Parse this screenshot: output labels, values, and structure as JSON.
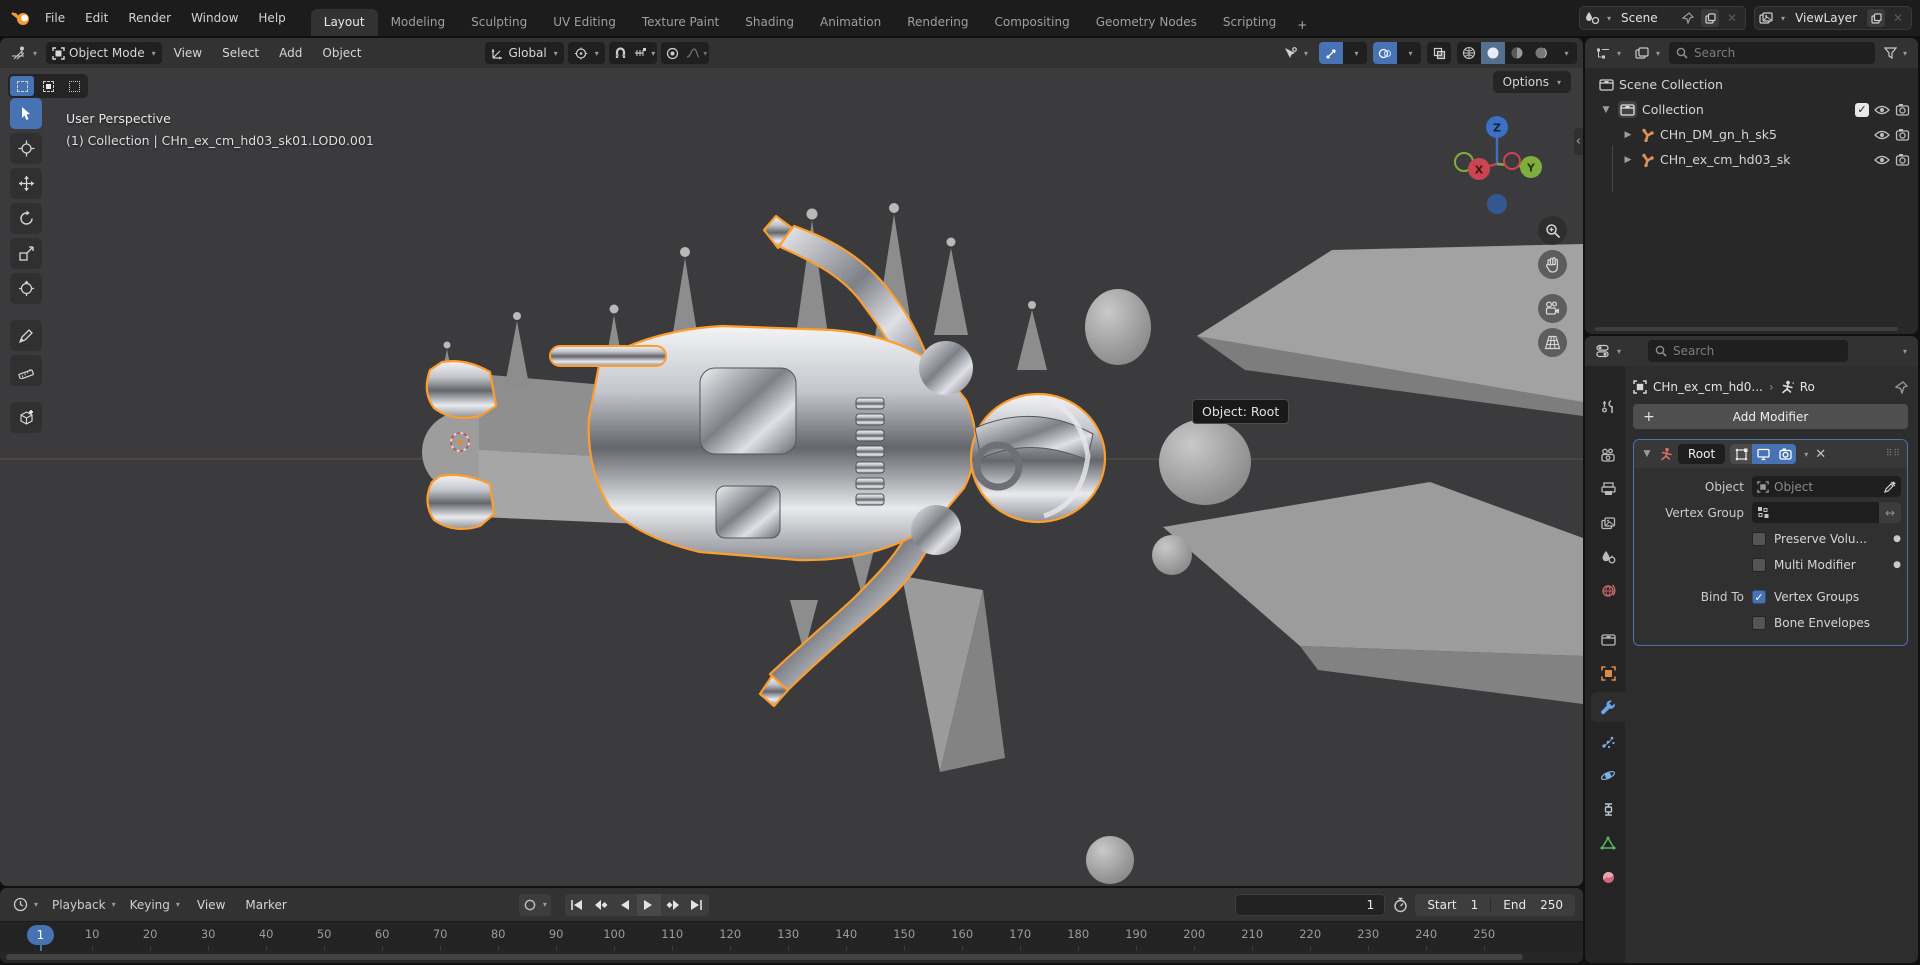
{
  "topbar": {
    "menus": [
      "File",
      "Edit",
      "Render",
      "Window",
      "Help"
    ],
    "tabs": [
      "Layout",
      "Modeling",
      "Sculpting",
      "UV Editing",
      "Texture Paint",
      "Shading",
      "Animation",
      "Rendering",
      "Compositing",
      "Geometry Nodes",
      "Scripting"
    ],
    "active_tab": "Layout",
    "new_tab_label": "+",
    "scene": {
      "value": "Scene"
    },
    "view_layer": {
      "value": "ViewLayer"
    }
  },
  "viewport_header": {
    "mode": "Object Mode",
    "menus": [
      "View",
      "Select",
      "Add",
      "Object"
    ],
    "orientation": "Global"
  },
  "viewport": {
    "projection_label": "User Perspective",
    "context_label": "(1) Collection | CHn_ex_cm_hd03_sk01.LOD0.001",
    "options_label": "Options",
    "tooltip": "Object: Root",
    "axis_labels": {
      "x": "X",
      "y": "Y",
      "z": "Z"
    },
    "tools": [
      "tweak-select",
      "cursor",
      "move",
      "rotate",
      "scale",
      "transform",
      "annotate",
      "measure",
      "add-cube"
    ],
    "active_tool": "tweak-select"
  },
  "outliner": {
    "search_placeholder": "Search",
    "rows": [
      {
        "label": "Scene Collection",
        "icon": "collection",
        "depth": 0
      },
      {
        "label": "Collection",
        "icon": "collection",
        "depth": 1,
        "expanded": true,
        "checkbox": true,
        "visible": true,
        "renderable": true
      },
      {
        "label": "CHn_DM_gn_h_sk5",
        "icon": "armature",
        "depth": 2,
        "visible": true,
        "renderable": true
      },
      {
        "label": "CHn_ex_cm_hd03_sk",
        "icon": "armature",
        "depth": 2,
        "visible": true,
        "renderable": true
      }
    ]
  },
  "properties": {
    "search_placeholder": "Search",
    "breadcrumb": {
      "object": "CHn_ex_cm_hd0...",
      "separator": "›",
      "modifier": "Ro"
    },
    "add_modifier_label": "Add Modifier",
    "tabs": [
      "tool",
      "render",
      "output",
      "view-layer",
      "scene",
      "world",
      "collection",
      "object",
      "modifiers",
      "particles",
      "physics",
      "constraints",
      "object-data",
      "material"
    ],
    "active_tab": "modifiers",
    "modifier": {
      "name": "Root",
      "object_label": "Object",
      "object_placeholder": "Object",
      "vertex_group_label": "Vertex Group",
      "options": [
        {
          "label": "Preserve Volu...",
          "checked": false
        },
        {
          "label": "Multi Modifier",
          "checked": false
        }
      ],
      "bind_to_label": "Bind To",
      "bind_options": [
        {
          "label": "Vertex Groups",
          "checked": true
        },
        {
          "label": "Bone Envelopes",
          "checked": false
        }
      ]
    }
  },
  "timeline": {
    "menus": [
      "Playback",
      "Keying",
      "View",
      "Marker"
    ],
    "current_frame": "1",
    "playhead_frame": 1,
    "start_label": "Start",
    "start_value": "1",
    "end_label": "End",
    "end_value": "250",
    "ruler_ticks": [
      10,
      20,
      30,
      40,
      50,
      60,
      70,
      80,
      90,
      100,
      110,
      120,
      130,
      140,
      150,
      160,
      170,
      180,
      190,
      200,
      210,
      220,
      230,
      240,
      250
    ]
  },
  "colors": {
    "accent": "#4772b3",
    "selection_outline": "#ff9d2e",
    "armature_icon": "#dd9059",
    "axis_x": "#cc4452",
    "axis_y": "#7fae3e",
    "axis_z": "#3d6fc4",
    "world_icon": "#c56767",
    "data_icon": "#56b860",
    "material_icon": "#cf6679",
    "modifier_icon": "#6aa3ee"
  }
}
